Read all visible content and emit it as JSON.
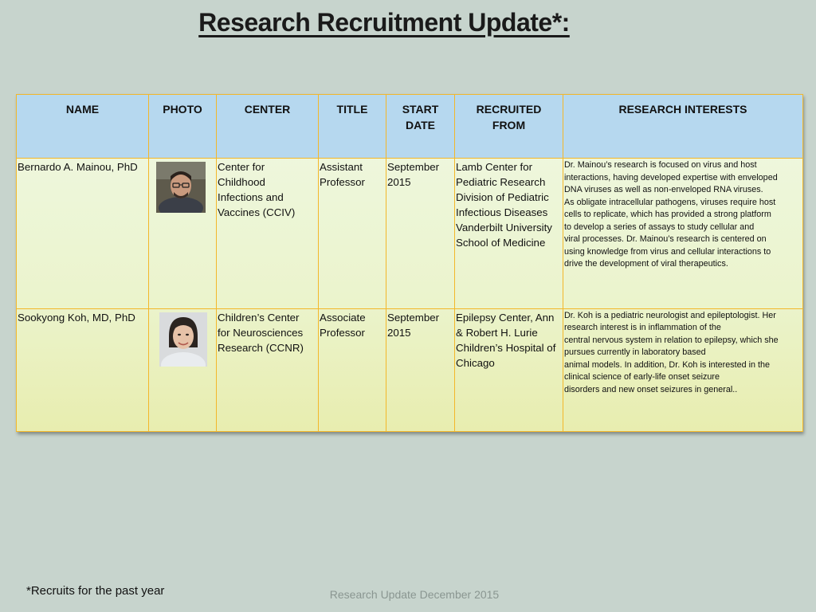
{
  "title": "Research Recruitment Update*:",
  "columns": [
    "NAME",
    "PHOTO",
    "CENTER",
    "TITLE",
    "START DATE",
    "RECRUITED FROM",
    "RESEARCH INTERESTS"
  ],
  "column_lines": {
    "start_date": [
      "START",
      "DATE"
    ],
    "recruited_from": [
      "RECRUITED",
      "FROM"
    ]
  },
  "rows": [
    {
      "name": "Bernardo A. Mainou, PhD",
      "photo": "portrait-photo",
      "center_lines": [
        "Center for",
        "Childhood",
        "Infections and",
        "Vaccines (CCIV)"
      ],
      "title_lines": [
        "Assistant",
        "Professor"
      ],
      "start_lines": [
        "September",
        "2015"
      ],
      "recruited_lines": [
        "Lamb Center for",
        "Pediatric Research",
        "Division of Pediatric",
        "Infectious Diseases",
        "Vanderbilt University",
        "School of Medicine"
      ],
      "interests_lines": [
        "Dr. Mainou’s research is focused on virus and host",
        "interactions, having developed expertise with enveloped",
        "DNA viruses as well as non-enveloped RNA viruses.",
        "As obligate intracellular pathogens, viruses require host",
        "cells to replicate, which has provided a strong platform",
        "to develop a series of assays to study cellular and",
        "viral processes. Dr. Mainou’s research is centered on",
        "using knowledge from virus and cellular interactions to",
        "drive the development of viral therapeutics."
      ]
    },
    {
      "name": "Sookyong Koh, MD, PhD",
      "photo": "portrait-photo",
      "center_lines": [
        "Children’s Center",
        "for Neurosciences",
        "Research (CCNR)"
      ],
      "title_lines": [
        "Associate",
        "Professor"
      ],
      "start_lines": [
        "September",
        "2015"
      ],
      "recruited_lines": [
        "Epilepsy Center, Ann",
        "& Robert H. Lurie",
        "Children’s Hospital of",
        "Chicago"
      ],
      "interests_lines": [
        "Dr. Koh is a pediatric neurologist and epileptologist. Her",
        "research interest is in inflammation of the",
        "central nervous system in relation to epilepsy, which she",
        "pursues currently in laboratory based",
        "animal models. In addition, Dr. Koh is interested in the",
        "clinical science of early-life onset seizure",
        "disorders and new onset seizures in general.."
      ]
    }
  ],
  "footnote": "*Recruits for the past year",
  "footer": "Research Update December 2015",
  "colors": {
    "background": "#c7d4cd",
    "header_fill": "#b6d8ef",
    "grid_border": "#f3b72a",
    "body_fill": "#ebf4cd"
  }
}
